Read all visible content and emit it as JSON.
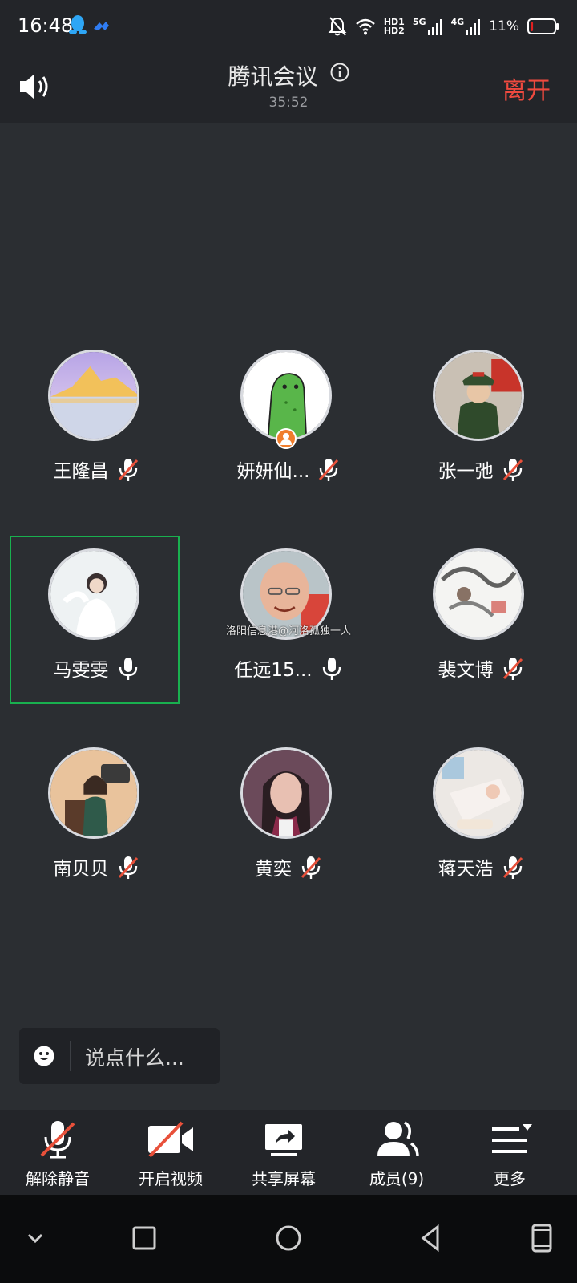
{
  "status_bar": {
    "time": "16:48",
    "net_hd1": "HD1",
    "net_hd2": "HD2",
    "net_5g": "5G",
    "net_4g": "4G",
    "battery_percent": "11%",
    "battery_level": 0.11,
    "icons": [
      "qq-icon",
      "cloud-icon",
      "mute-notification-icon",
      "wifi-icon",
      "signal-icon",
      "battery-icon"
    ],
    "battery_color": "#e02020"
  },
  "header": {
    "title": "腾讯会议",
    "duration": "35:52",
    "leave_label": "离开",
    "leave_color": "#ef4a3f"
  },
  "participants": [
    {
      "name": "王隆昌",
      "muted": true
    },
    {
      "name": "妍妍仙...",
      "muted": true,
      "host": true
    },
    {
      "name": "张一弛",
      "muted": true
    },
    {
      "name": "马雯雯",
      "muted": false,
      "active": true
    },
    {
      "name": "任远15...",
      "muted": false
    },
    {
      "name": "裴文博",
      "muted": true
    },
    {
      "name": "南贝贝",
      "muted": true
    },
    {
      "name": "黄奕",
      "muted": true
    },
    {
      "name": "蒋天浩",
      "muted": true
    }
  ],
  "watermark": "洛阳信息港@河洛孤独一人",
  "chat": {
    "placeholder": "说点什么..."
  },
  "toolbar": {
    "unmute_label": "解除静音",
    "video_label": "开启视频",
    "share_label": "共享屏幕",
    "members_label": "成员(9)",
    "more_label": "更多"
  },
  "accent_colors": {
    "active_border": "#19b04f",
    "mute_slash": "#e8503a"
  }
}
